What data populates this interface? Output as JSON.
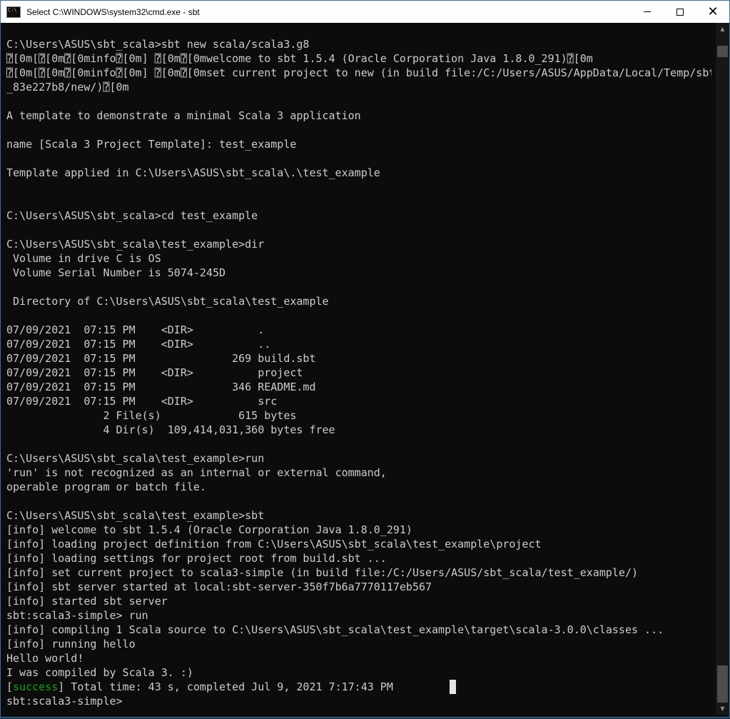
{
  "window": {
    "title": "Select C:\\WINDOWS\\system32\\cmd.exe - sbt",
    "minimize_glyph": "—",
    "maximize_glyph": "☐",
    "close_glyph": "✕"
  },
  "console": {
    "lines": [
      "C:\\Users\\ASUS\\sbt_scala>sbt new scala/scala3.g8",
      "⍰[0m[⍰[0m⍰[0minfo⍰[0m] ⍰[0m⍰[0mwelcome to sbt 1.5.4 (Oracle Corporation Java 1.8.0_291)⍰[0m",
      "⍰[0m[⍰[0m⍰[0minfo⍰[0m] ⍰[0m⍰[0mset current project to new (in build file:/C:/Users/ASUS/AppData/Local/Temp/sbt",
      "_83e227b8/new/)⍰[0m",
      "",
      "A template to demonstrate a minimal Scala 3 application",
      "",
      "name [Scala 3 Project Template]: test_example",
      "",
      "Template applied in C:\\Users\\ASUS\\sbt_scala\\.\\test_example",
      "",
      "",
      "C:\\Users\\ASUS\\sbt_scala>cd test_example",
      "",
      "C:\\Users\\ASUS\\sbt_scala\\test_example>dir",
      " Volume in drive C is OS",
      " Volume Serial Number is 5074-245D",
      "",
      " Directory of C:\\Users\\ASUS\\sbt_scala\\test_example",
      "",
      "07/09/2021  07:15 PM    <DIR>          .",
      "07/09/2021  07:15 PM    <DIR>          ..",
      "07/09/2021  07:15 PM               269 build.sbt",
      "07/09/2021  07:15 PM    <DIR>          project",
      "07/09/2021  07:15 PM               346 README.md",
      "07/09/2021  07:15 PM    <DIR>          src",
      "               2 File(s)            615 bytes",
      "               4 Dir(s)  109,414,031,360 bytes free",
      "",
      "C:\\Users\\ASUS\\sbt_scala\\test_example>run",
      "'run' is not recognized as an internal or external command,",
      "operable program or batch file.",
      "",
      "C:\\Users\\ASUS\\sbt_scala\\test_example>sbt",
      "[info] welcome to sbt 1.5.4 (Oracle Corporation Java 1.8.0_291)",
      "[info] loading project definition from C:\\Users\\ASUS\\sbt_scala\\test_example\\project",
      "[info] loading settings for project root from build.sbt ...",
      "[info] set current project to scala3-simple (in build file:/C:/Users/ASUS/sbt_scala/test_example/)",
      "[info] sbt server started at local:sbt-server-350f7b6a7770117eb567",
      "[info] started sbt server",
      "sbt:scala3-simple> run",
      "[info] compiling 1 Scala source to C:\\Users\\ASUS\\sbt_scala\\test_example\\target\\scala-3.0.0\\classes ...",
      "[info] running hello",
      "Hello world!",
      "I was compiled by Scala 3. :)"
    ],
    "success_open": "[",
    "success_word": "success",
    "success_rest": "] Total time: 43 s, completed Jul 9, 2021 7:17:43 PM",
    "prompt": "sbt:scala3-simple> "
  },
  "colors": {
    "console_bg": "#0c0c0c",
    "console_fg": "#cccccc",
    "success_green": "#13a10e"
  },
  "icons": {
    "app": "cmd-app-icon",
    "scroll_up": "chevron-up-icon",
    "scroll_down": "chevron-down-icon"
  }
}
